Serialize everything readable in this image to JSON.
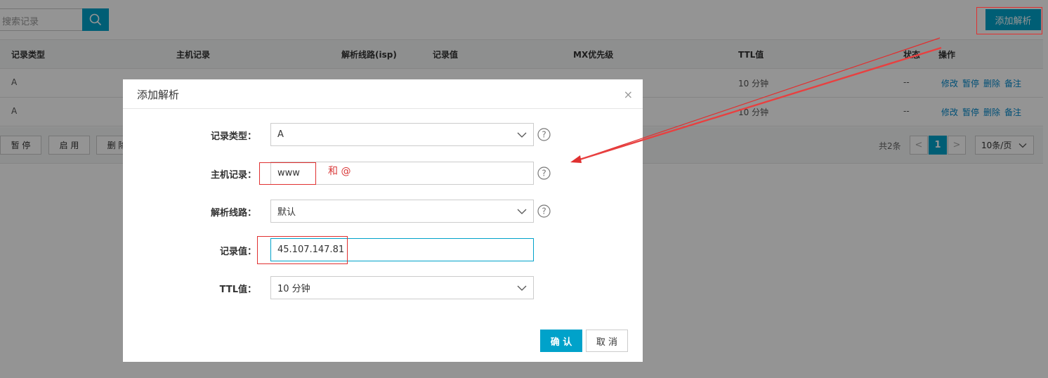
{
  "toolbar": {
    "search_placeholder": "搜索记录",
    "add_button": "添加解析"
  },
  "table": {
    "headers": [
      "记录类型",
      "主机记录",
      "解析线路(isp)",
      "记录值",
      "MX优先级",
      "TTL值",
      "状态",
      "操作"
    ],
    "rows": [
      {
        "type": "A",
        "ttl": "10 分钟",
        "status": "--"
      },
      {
        "type": "A",
        "ttl": "10 分钟",
        "status": "--"
      }
    ],
    "ops": [
      "修改",
      "暂停",
      "删除",
      "备注"
    ]
  },
  "footer": {
    "buttons": [
      "暂 停",
      "启 用",
      "删 除"
    ],
    "total": "共2条",
    "prev": "<",
    "page": "1",
    "next": ">",
    "page_size": "10条/页"
  },
  "modal": {
    "title": "添加解析",
    "close": "×",
    "fields": {
      "record_type": {
        "label": "记录类型：",
        "value": "A"
      },
      "host": {
        "label": "主机记录：",
        "value": "www"
      },
      "line": {
        "label": "解析线路：",
        "value": "默认"
      },
      "value": {
        "label": "记录值：",
        "value": "45.107.147.81"
      },
      "ttl": {
        "label": "TTL值：",
        "value": "10 分钟"
      }
    },
    "confirm": "确 认",
    "cancel": "取 消"
  },
  "annotation": {
    "note": "和 @",
    "color": "#e03030"
  },
  "colors": {
    "accent": "#00a2ca",
    "link": "#0088cc"
  }
}
